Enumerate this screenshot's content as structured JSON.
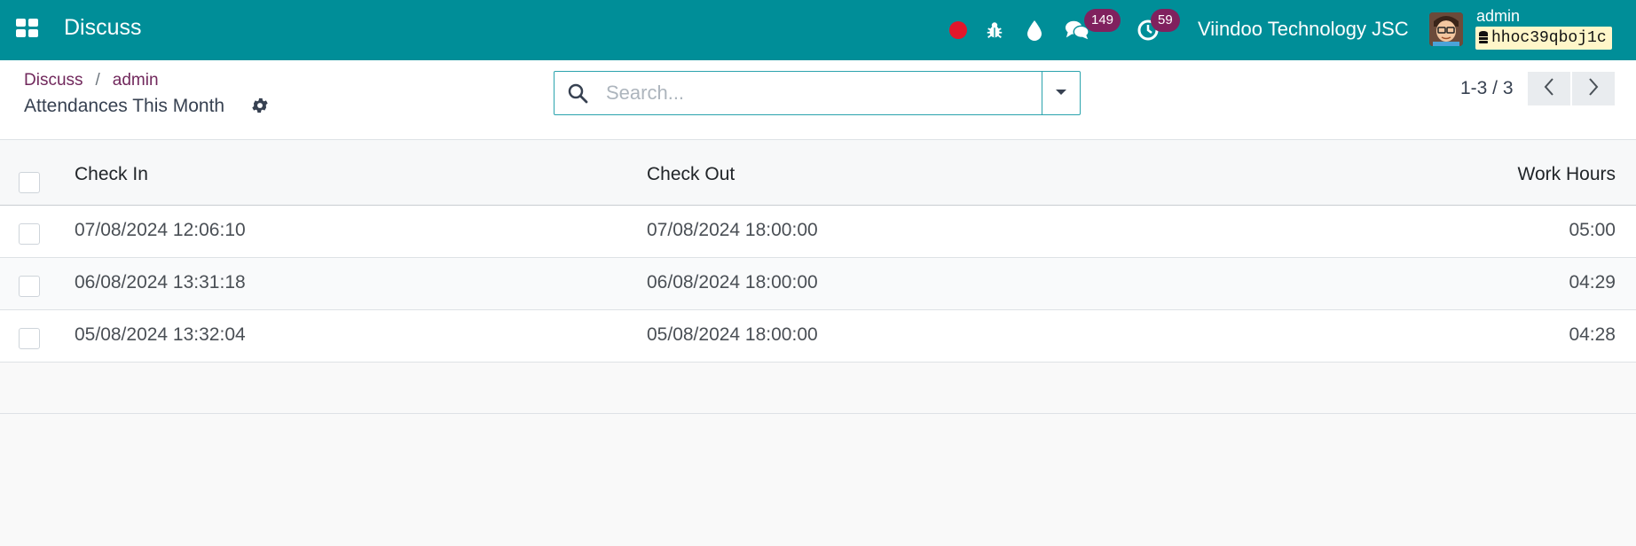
{
  "navbar": {
    "app_name": "Discuss",
    "messages_count": "149",
    "activities_count": "59",
    "company": "Viindoo Technology JSC",
    "user": "admin",
    "database": "hhoc39qboj1c"
  },
  "breadcrumb": {
    "root": "Discuss",
    "separator": "/",
    "current": "admin"
  },
  "view_title": "Attendances This Month",
  "search": {
    "placeholder": "Search..."
  },
  "pager": {
    "value": "1-3 / 3"
  },
  "table": {
    "headers": {
      "check_in": "Check In",
      "check_out": "Check Out",
      "work_hours": "Work Hours"
    },
    "rows": [
      {
        "check_in": "07/08/2024 12:06:10",
        "check_out": "07/08/2024 18:00:00",
        "work_hours": "05:00"
      },
      {
        "check_in": "06/08/2024 13:31:18",
        "check_out": "06/08/2024 18:00:00",
        "work_hours": "04:29"
      },
      {
        "check_in": "05/08/2024 13:32:04",
        "check_out": "05/08/2024 18:00:00",
        "work_hours": "04:28"
      }
    ]
  },
  "colors": {
    "navbar": "#008e98",
    "accent": "#71285c",
    "badge": "#80215e",
    "record": "#e2162a"
  }
}
